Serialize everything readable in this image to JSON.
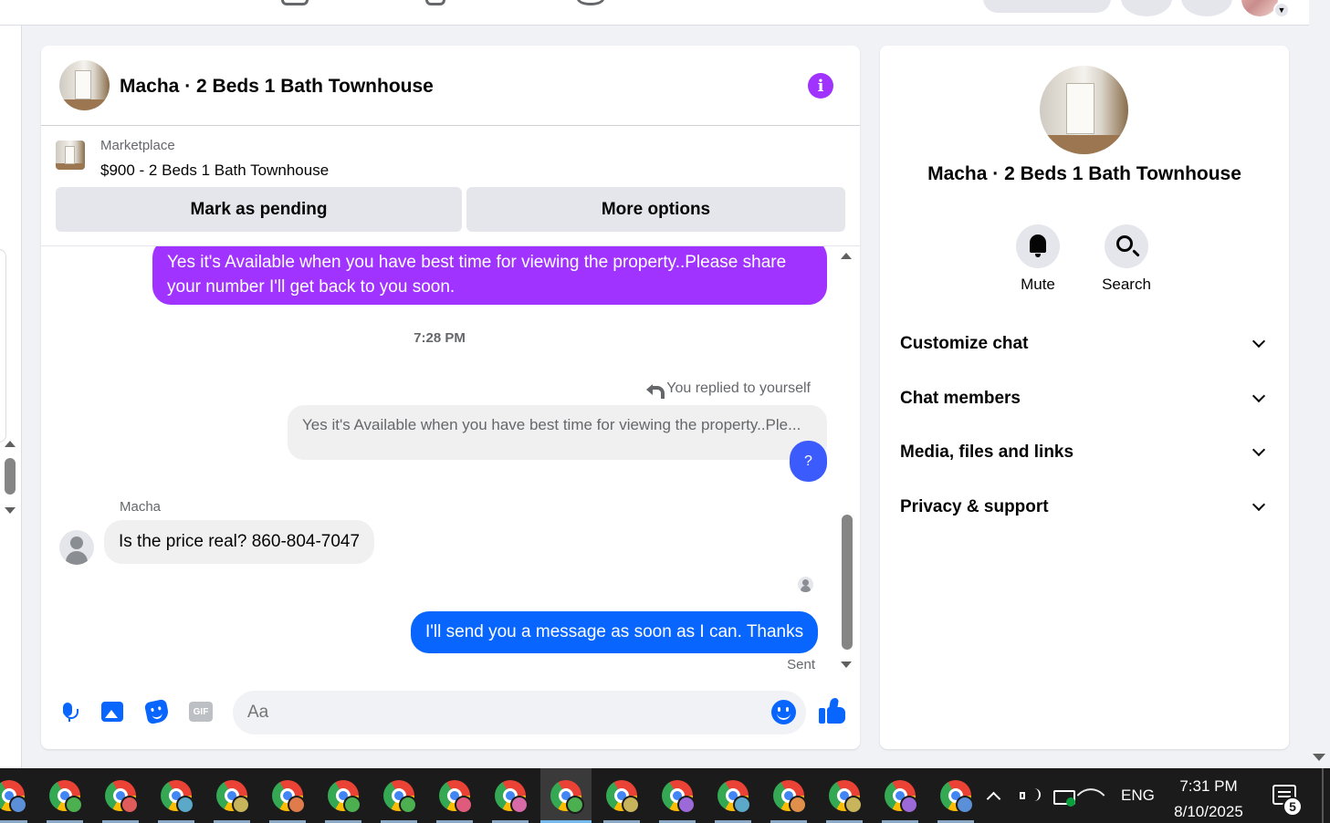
{
  "chat": {
    "title": "Macha · 2 Beds 1 Bath Townhouse",
    "marketplace_label": "Marketplace",
    "listing": "$900 - 2 Beds 1 Bath Townhouse",
    "mark_pending_label": "Mark as pending",
    "more_options_label": "More options",
    "messages": {
      "outgoing_1": "Yes it's Available when you have best time for viewing the property..Please share your number I'll get back to you soon.",
      "time_separator": "7:28 PM",
      "replied_label": "You replied to yourself",
      "quoted_text": "Yes it's Available when you have best time for viewing the property..Ple...",
      "reply_bubble": "?",
      "sender_name": "Macha",
      "incoming_1": "Is the price real? 860-804-7047",
      "outgoing_2": "I'll send you a message as soon as I can. Thanks",
      "status": "Sent"
    },
    "composer": {
      "placeholder": "Aa",
      "gif_label": "GIF"
    }
  },
  "info_panel": {
    "title": "Macha · 2 Beds 1 Bath Townhouse",
    "actions": [
      {
        "label": "Mute",
        "icon": "bell-icon"
      },
      {
        "label": "Search",
        "icon": "search-icon"
      }
    ],
    "sections": [
      "Customize chat",
      "Chat members",
      "Media, files and links",
      "Privacy & support"
    ]
  },
  "taskbar": {
    "app_count": 17,
    "active_index": 10,
    "badge_colors": [
      "#5b8fd8",
      "#4caf50",
      "#e05b5b",
      "#5ba8c8",
      "#c8b45b",
      "#e07b4b",
      "#4caf50",
      "#4caf50",
      "#e05b7b",
      "#d86aa8",
      "#4caf50",
      "#c8b45b",
      "#9b6ad8",
      "#5ba8c8",
      "#e0904b",
      "#c8b45b",
      "#9b6ad8",
      "#5b8fd8"
    ],
    "language": "ENG",
    "time": "7:31 PM",
    "date": "8/10/2025",
    "notification_count": "5"
  },
  "colors": {
    "accent_purple": "#a033ff",
    "messenger_blue": "#0866ff",
    "reply_blue": "#3b5bfd"
  }
}
